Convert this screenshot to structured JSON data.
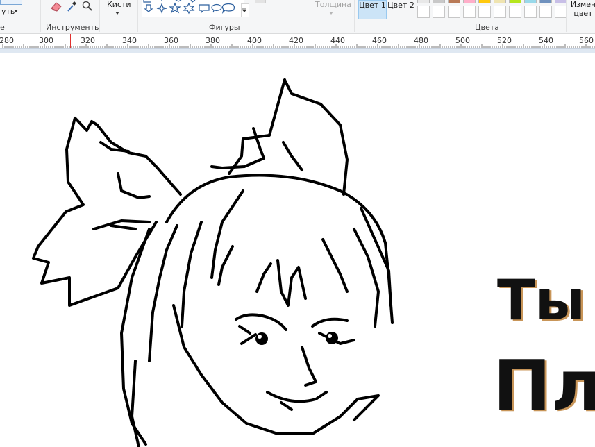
{
  "ribbon": {
    "paste_fragment": "уть",
    "groups": {
      "image_fragment": "е",
      "tools": "Инструменты",
      "shapes": "Фигуры",
      "colors": "Цвета"
    },
    "brushes_label": "Кисти",
    "thickness_label": "Толщина",
    "color1_label": "Цвет 1",
    "color2_label": "Цвет 2",
    "edit_colors_label": "Измен цвет",
    "palette_top": [
      "#e8e8e8",
      "#c8c8c8",
      "#b97a57",
      "#ffaec9",
      "#ffc90e",
      "#efe4b0",
      "#b5e61d",
      "#99d9ea",
      "#7092be",
      "#c8bfe7"
    ]
  },
  "ruler": {
    "labels": [
      "280",
      "300",
      "320",
      "340",
      "360",
      "380",
      "400",
      "420",
      "440",
      "460",
      "480",
      "500",
      "520",
      "540",
      "560"
    ]
  },
  "canvas": {
    "sign_line1": "Ты",
    "sign_line2": "Пл"
  }
}
